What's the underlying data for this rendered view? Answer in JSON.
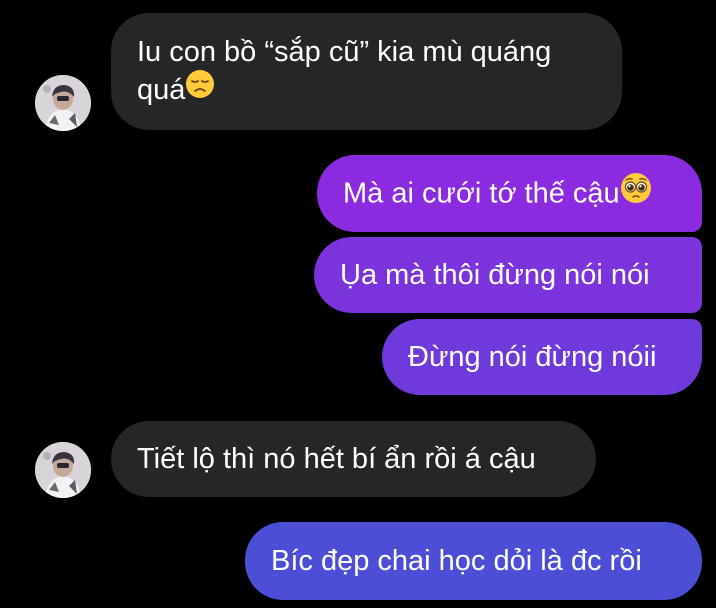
{
  "messages": [
    {
      "direction": "incoming",
      "text": "Iu con bồ “sắp cũ” kia mù quáng",
      "text_line2": "quá",
      "emoji": "disappointed-face-emoji"
    },
    {
      "direction": "outgoing",
      "text": "Mà ai cưới tớ thế cậu",
      "emoji": "pleading-face-emoji"
    },
    {
      "direction": "outgoing",
      "text": "Ụa mà thôi đừng nói nói"
    },
    {
      "direction": "outgoing",
      "text": "Đừng nói đừng nóii"
    },
    {
      "direction": "incoming",
      "text": "Tiết lộ thì nó hết bí ẩn rồi á cậu"
    },
    {
      "direction": "outgoing",
      "text": "Bíc đẹp chai học dỏi là đc rồi"
    }
  ],
  "colors": {
    "background": "#000000",
    "incoming_bubble": "#262626",
    "outgoing_top": "#8e2bd8",
    "outgoing_bottom": "#4c4fd6",
    "emoji_yellow": "#ffcb3d"
  }
}
